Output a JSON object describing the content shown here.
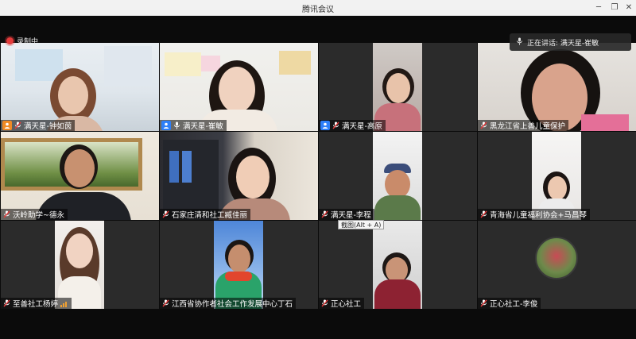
{
  "window": {
    "title": "腾讯会议"
  },
  "status": {
    "recording": "录制中",
    "speaking": "正在讲话: 满天星-崔敏"
  },
  "tooltip": "截图(Alt + A)",
  "participants": [
    {
      "name": "满天星-钟如茵",
      "badge": "orange"
    },
    {
      "name": "满天星-崔敏",
      "badge": "blue"
    },
    {
      "name": "满天星-高原",
      "badge": "blue"
    },
    {
      "name": "黑龙江省上善儿童保护",
      "badge": ""
    },
    {
      "name": "沃岭助学~德永",
      "badge": ""
    },
    {
      "name": "石家庄清和社工臧佳丽",
      "badge": ""
    },
    {
      "name": "满天星-李程",
      "badge": ""
    },
    {
      "name": "青海省儿童福利协会+马昌琴",
      "badge": ""
    },
    {
      "name": "至善社工杨婷",
      "badge": ""
    },
    {
      "name": "江西省协作者社会工作发展中心丁石",
      "badge": ""
    },
    {
      "name": "正心社工",
      "badge": ""
    },
    {
      "name": "正心社工-李俊",
      "badge": ""
    }
  ],
  "colors": {
    "badge_blue": "#2d7ff9",
    "badge_orange": "#f08a24",
    "record_red": "#e33b3b"
  }
}
